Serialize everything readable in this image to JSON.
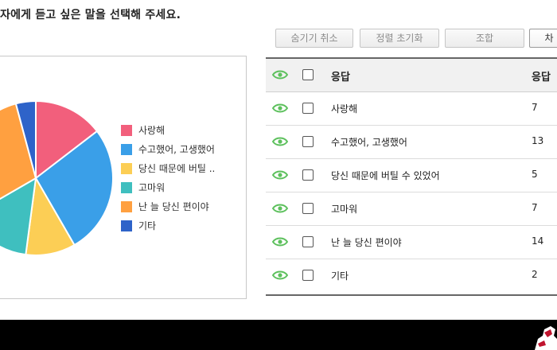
{
  "question": "자에게 듣고 싶은 말을 선택해 주세요.",
  "toolbar": {
    "hide_cancel": "숨기기 취소",
    "reset_sort": "정렬 초기화",
    "combine": "조합",
    "next_partial": "차"
  },
  "chart_data": {
    "type": "pie",
    "title": "",
    "slices": [
      {
        "label": "사랑해",
        "value": 7,
        "color": "#f25f7c"
      },
      {
        "label": "수고했어, 고생했어",
        "value": 13,
        "color": "#3a9fe8"
      },
      {
        "label": "당신 때문에 버틸 ..",
        "value": 5,
        "color": "#fcce55"
      },
      {
        "label": "고마워",
        "value": 7,
        "color": "#3fbfbf"
      },
      {
        "label": "난 늘 당신 편이야",
        "value": 14,
        "color": "#ffa040"
      },
      {
        "label": "기타",
        "value": 2,
        "color": "#2e63c9"
      }
    ],
    "legend": "right"
  },
  "table": {
    "header_response": "응답",
    "header_count": "응답",
    "rows": [
      {
        "response": "사랑해",
        "count": "7"
      },
      {
        "response": "수고했어, 고생했어",
        "count": "13"
      },
      {
        "response": "당신 때문에 버틸 수 있었어",
        "count": "5"
      },
      {
        "response": "고마워",
        "count": "7"
      },
      {
        "response": "난 늘 당신 편이야",
        "count": "14"
      },
      {
        "response": "기타",
        "count": "2"
      }
    ]
  },
  "colors": {
    "eye_icon": "#5cc05c",
    "table_border": "#666666"
  }
}
